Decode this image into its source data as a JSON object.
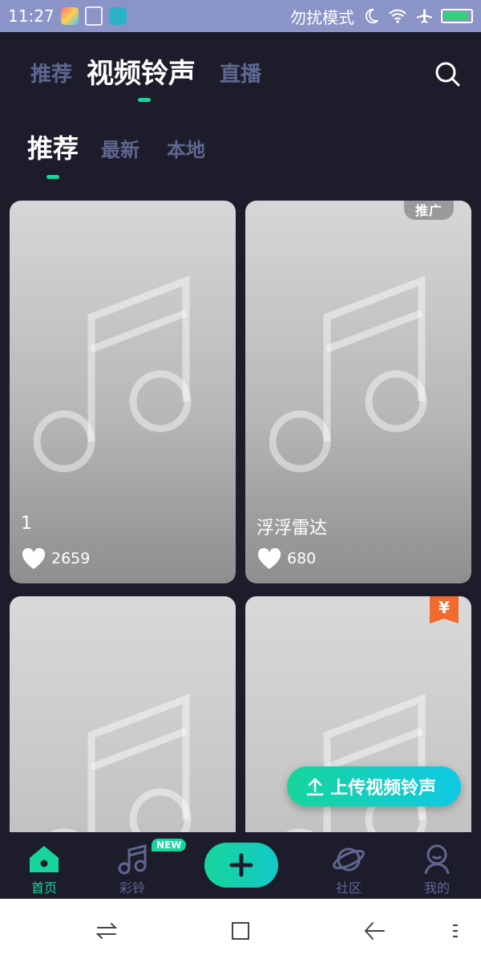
{
  "status_bar": {
    "time": "11:27",
    "dnd_label": "勿扰模式",
    "icons": [
      "photo-app-icon",
      "clipboard-icon",
      "usb-icon",
      "moon-icon",
      "wifi-icon",
      "airplane-icon",
      "battery-icon"
    ]
  },
  "header": {
    "tabs": [
      {
        "label": "推荐"
      },
      {
        "label": "视频铃声"
      },
      {
        "label": "直播"
      }
    ],
    "active_tab": "视频铃声"
  },
  "sub_tabs": [
    {
      "label": "推荐"
    },
    {
      "label": "最新"
    },
    {
      "label": "本地"
    }
  ],
  "cards": [
    {
      "title": "1",
      "likes": "2659"
    },
    {
      "title": "浮浮雷达",
      "likes": "680",
      "badge": "推广"
    },
    {
      "title": "",
      "likes": ""
    },
    {
      "title": "",
      "likes": "",
      "badge": "¥"
    }
  ],
  "upload_button": {
    "label": "上传视频铃声"
  },
  "bottom_nav": {
    "items": [
      {
        "label": "首页"
      },
      {
        "label": "彩铃",
        "badge": "NEW"
      },
      {
        "label": "社区"
      },
      {
        "label": "我的"
      }
    ]
  },
  "colors": {
    "background": "#1d1c2b",
    "accent": "#16d69b",
    "inactive": "#5f6790",
    "status_bar": "#8a94c7"
  }
}
